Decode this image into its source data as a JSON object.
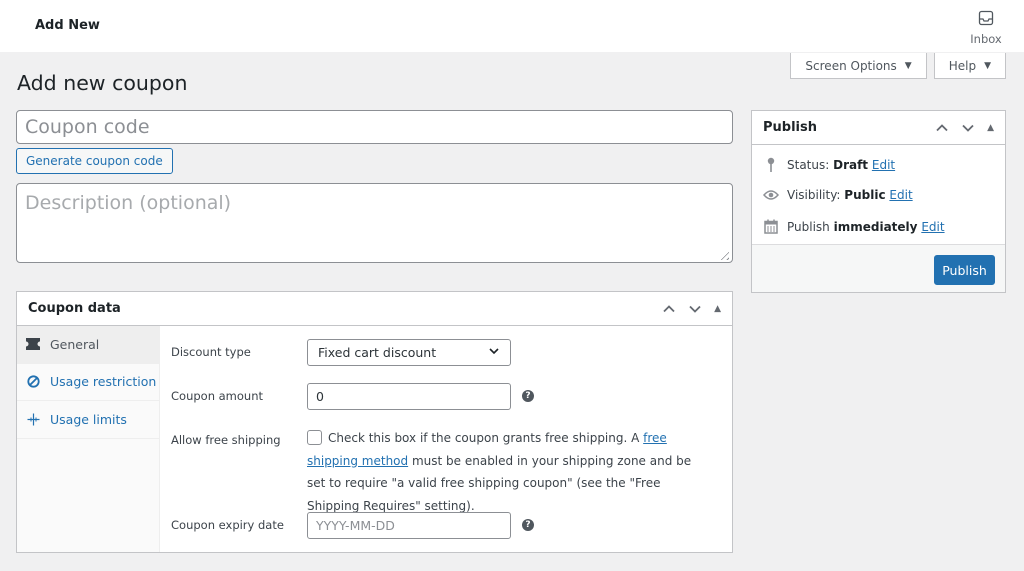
{
  "topbar": {
    "title": "Add New",
    "inbox_label": "Inbox"
  },
  "screen_tabs": {
    "screen_options": "Screen Options",
    "help": "Help"
  },
  "page_title": "Add new coupon",
  "coupon_code": {
    "placeholder": "Coupon code",
    "value": ""
  },
  "generate_button": "Generate coupon code",
  "description": {
    "placeholder": "Description (optional)",
    "value": ""
  },
  "coupon_data": {
    "title": "Coupon data",
    "tabs": [
      {
        "label": "General",
        "icon": "ticket-icon",
        "active": true
      },
      {
        "label": "Usage restriction",
        "icon": "block-icon",
        "active": false
      },
      {
        "label": "Usage limits",
        "icon": "limits-icon",
        "active": false
      }
    ],
    "general": {
      "discount_type_label": "Discount type",
      "discount_type_value": "Fixed cart discount",
      "amount_label": "Coupon amount",
      "amount_value": "0",
      "free_shipping_label": "Allow free shipping",
      "free_shipping_checked": false,
      "free_shipping_text_1": "Check this box if the coupon grants free shipping. A",
      "free_shipping_link": "free shipping method",
      "free_shipping_text_2": "must be enabled in your shipping zone and be set to require \"a valid free shipping coupon\" (see the \"Free Shipping Requires\" setting).",
      "expiry_label": "Coupon expiry date",
      "expiry_placeholder": "YYYY-MM-DD"
    }
  },
  "publish": {
    "title": "Publish",
    "status_label": "Status:",
    "status_value": "Draft",
    "visibility_label": "Visibility:",
    "visibility_value": "Public",
    "publish_label": "Publish",
    "publish_value": "immediately",
    "edit_link": "Edit",
    "publish_button": "Publish"
  },
  "colors": {
    "accent": "#2271b1",
    "background": "#f0f0f1",
    "border": "#c3c4c7"
  }
}
